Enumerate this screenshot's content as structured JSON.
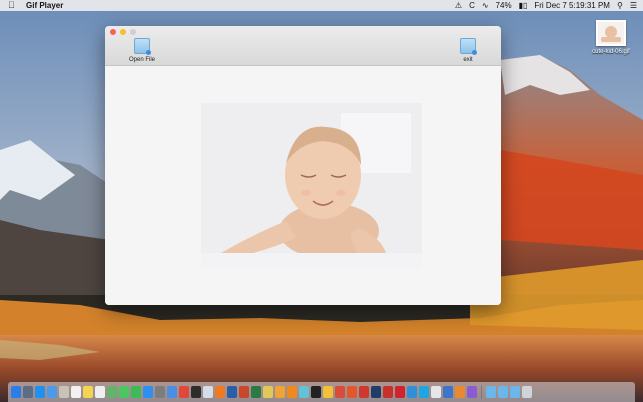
{
  "menubar": {
    "apple_icon": "apple-icon",
    "app_name": "Gif Player",
    "status_icons": [
      "alert-icon",
      "c-icon",
      "wifi-icon",
      "battery-icon"
    ],
    "battery_percent": "74%",
    "datetime": "Fri Dec 7  5:19:31 PM",
    "search_icon": "search-icon",
    "list_icon": "list-icon"
  },
  "window": {
    "toolbar": {
      "open_label": "Open File",
      "exit_label": "exit"
    }
  },
  "desktop_file": {
    "label": "cute-kid-06.gif"
  },
  "dock": {
    "apps": [
      {
        "name": "finder-icon",
        "color": "#2b7de9"
      },
      {
        "name": "launchpad-icon",
        "color": "#5b6c85"
      },
      {
        "name": "safari-icon",
        "color": "#1f8ff0"
      },
      {
        "name": "mail-icon",
        "color": "#4d9be8"
      },
      {
        "name": "photos-icon",
        "color": "#c9c2b8"
      },
      {
        "name": "calendar-icon",
        "color": "#f1f1f1"
      },
      {
        "name": "notes-icon",
        "color": "#f4d451"
      },
      {
        "name": "reminders-icon",
        "color": "#efefef"
      },
      {
        "name": "maps-icon",
        "color": "#64b36a"
      },
      {
        "name": "messages-icon",
        "color": "#4bc661"
      },
      {
        "name": "facetime-icon",
        "color": "#3dbb59"
      },
      {
        "name": "app-store-icon",
        "color": "#2e8ff0"
      },
      {
        "name": "preferences-icon",
        "color": "#7d7d7d"
      },
      {
        "name": "xcode-icon",
        "color": "#4a8fe3"
      },
      {
        "name": "chrome-icon",
        "color": "#e1483a"
      },
      {
        "name": "terminal-icon",
        "color": "#2d2d2d"
      },
      {
        "name": "preview-icon",
        "color": "#d5dde8"
      },
      {
        "name": "firefox-icon",
        "color": "#f07a23"
      },
      {
        "name": "word-icon",
        "color": "#2b5ea8"
      },
      {
        "name": "powerpoint-icon",
        "color": "#c9472b"
      },
      {
        "name": "excel-icon",
        "color": "#2c7a43"
      },
      {
        "name": "script-icon",
        "color": "#e2c75a"
      },
      {
        "name": "pages-icon",
        "color": "#f0a336"
      },
      {
        "name": "vlc-icon",
        "color": "#f08a1e"
      },
      {
        "name": "paint-icon",
        "color": "#63c1d8"
      },
      {
        "name": "ball-icon",
        "color": "#222222"
      },
      {
        "name": "sketch-icon",
        "color": "#f3c03a"
      },
      {
        "name": "activity-icon",
        "color": "#d94b3b"
      },
      {
        "name": "java-icon",
        "color": "#e2572c"
      },
      {
        "name": "idea-icon",
        "color": "#d0372f"
      },
      {
        "name": "photoshop-icon",
        "color": "#1f3d66"
      },
      {
        "name": "adobe-icon",
        "color": "#c8312b"
      },
      {
        "name": "opera-icon",
        "color": "#d2222d"
      },
      {
        "name": "scanner-icon",
        "color": "#2f8fd8"
      },
      {
        "name": "skype-icon",
        "color": "#1ea5e3"
      },
      {
        "name": "textedit-icon",
        "color": "#e7e7e7"
      },
      {
        "name": "firefox-dev-icon",
        "color": "#3e74c9"
      },
      {
        "name": "app-icon",
        "color": "#e88b2f"
      },
      {
        "name": "gif-player-icon",
        "color": "#8a5cd0"
      }
    ],
    "folders": [
      {
        "name": "downloads-folder-icon",
        "color": "#6bb6ea"
      },
      {
        "name": "documents-folder-icon",
        "color": "#6bb6ea"
      },
      {
        "name": "applications-folder-icon",
        "color": "#6bb6ea"
      },
      {
        "name": "trash-icon",
        "color": "#cfd4da"
      }
    ]
  }
}
